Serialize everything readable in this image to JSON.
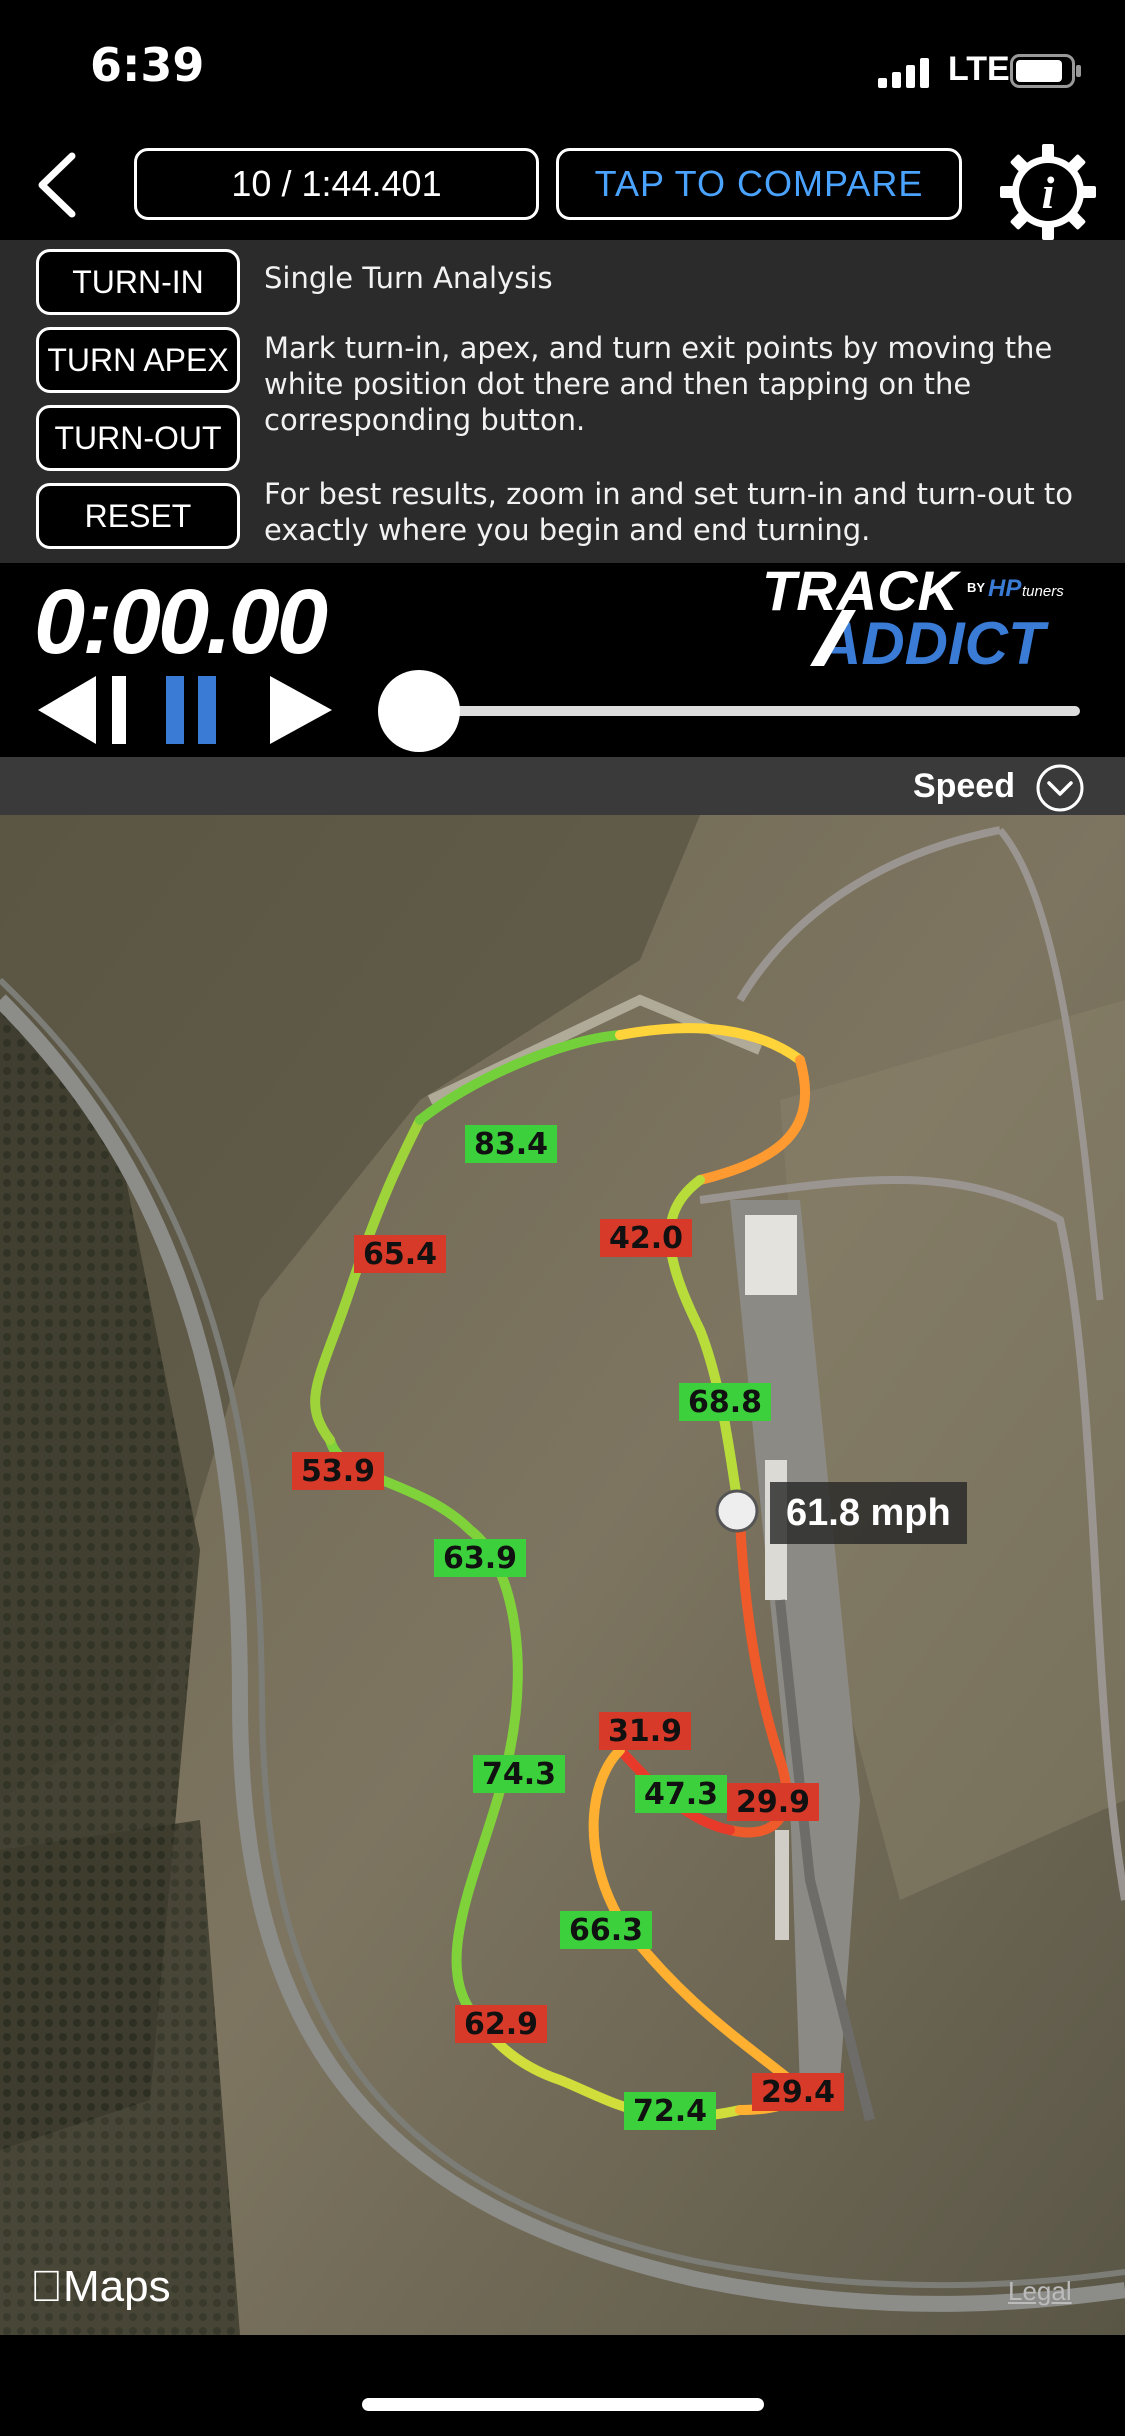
{
  "status_bar": {
    "time": "6:39",
    "network": "LTE"
  },
  "header": {
    "back_icon": "chevron-left-icon",
    "lap_label": "10 / 1:44.401",
    "compare_label": "TAP TO COMPARE",
    "info_icon": "info-gear-icon",
    "compare_color": "#4aa3ff"
  },
  "panel": {
    "buttons": [
      "TURN-IN",
      "TURN APEX",
      "TURN-OUT",
      "RESET"
    ],
    "title": "Single Turn Analysis",
    "instructions": "Mark turn-in, apex, and turn exit points by moving the white position dot there and then tapping on the corresponding button.",
    "tip": "For best results, zoom in and set turn-in and turn-out to exactly where you begin and end turning."
  },
  "player": {
    "timer": "0:00.00",
    "logo_line1": "TRACK",
    "logo_by": "BY",
    "logo_hp": "HP",
    "logo_tuners": "tuners",
    "logo_line2": "ADDICT",
    "logo_accent": "#3a7bd5",
    "scrub_progress": 0.0
  },
  "data_selector": {
    "label": "Speed",
    "icon": "chevron-down-circle-icon"
  },
  "map": {
    "speed_tags": [
      {
        "value": "83.4",
        "status": "green"
      },
      {
        "value": "65.4",
        "status": "red"
      },
      {
        "value": "42.0",
        "status": "red"
      },
      {
        "value": "68.8",
        "status": "green"
      },
      {
        "value": "53.9",
        "status": "red"
      },
      {
        "value": "63.9",
        "status": "green"
      },
      {
        "value": "31.9",
        "status": "red"
      },
      {
        "value": "47.3",
        "status": "green"
      },
      {
        "value": "29.9",
        "status": "red"
      },
      {
        "value": "74.3",
        "status": "green"
      },
      {
        "value": "66.3",
        "status": "green"
      },
      {
        "value": "62.9",
        "status": "red"
      },
      {
        "value": "72.4",
        "status": "green"
      },
      {
        "value": "29.4",
        "status": "red"
      }
    ],
    "position_readout": "61.8 mph",
    "attribution": "Maps",
    "legal": "Legal"
  }
}
